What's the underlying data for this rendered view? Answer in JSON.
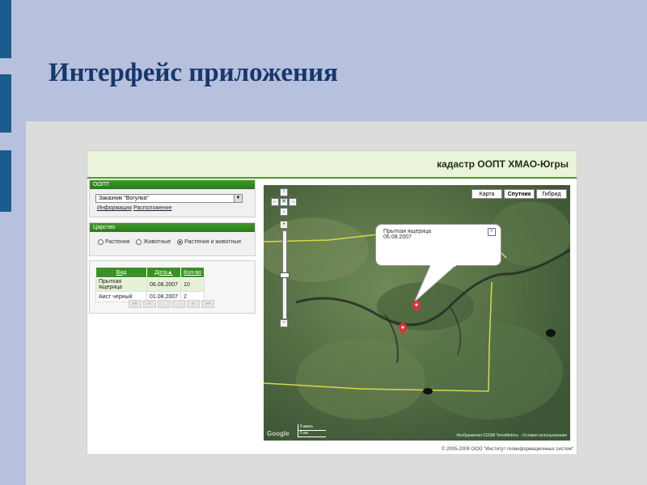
{
  "slide": {
    "title": "Интерфейс приложения"
  },
  "app": {
    "header_title": "кадастр ООПТ ХМАО-Югры",
    "footer": "© 2005-2008 ООО \"Институт геоинформационных систем\""
  },
  "oopt": {
    "header": "ООПТ",
    "selected": "Заказник \"Вогулка\"",
    "link_info": "Информация",
    "link_location": "Расположение"
  },
  "kingdom": {
    "header": "Царство",
    "options": [
      "Растения",
      "Животные",
      "Растения и животные"
    ],
    "selected_index": 2
  },
  "records": {
    "columns": [
      "Вид",
      "Дата▲",
      "Кол-во"
    ],
    "rows": [
      [
        "Прыткая ящерица",
        "06.08.2007",
        "10"
      ],
      [
        "Аист черный",
        "01.08.2007",
        "2"
      ]
    ],
    "pager": [
      "<<",
      "<",
      "",
      "",
      ">",
      ">>"
    ]
  },
  "map": {
    "types": [
      "Карта",
      "Спутник",
      "Гибрид"
    ],
    "active_type": "Спутник",
    "popup": {
      "title": "Прыткая ящерица",
      "date": "06.08.2007"
    },
    "scale": [
      "5 миль",
      "5 км"
    ],
    "copyright": "Изображения ©2008 TerraMetrics · Условия использования",
    "logo": "Google"
  },
  "colors": {
    "header_green": "#3c8f2a",
    "title_blue": "#17376d",
    "slide_bg": "#b7c0dc"
  }
}
